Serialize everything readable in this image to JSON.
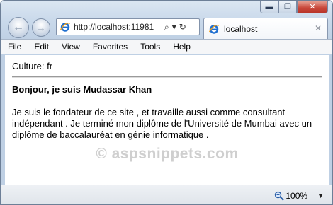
{
  "window": {
    "url": "http://localhost:11981",
    "tab_title": "localhost",
    "minimize_glyph": "▬",
    "restore_glyph": "❐",
    "close_glyph": "✕",
    "back_glyph": "←",
    "forward_glyph": "→",
    "search_glyph": "⌕",
    "dropdown_glyph": "▾",
    "refresh_glyph": "↻",
    "tab_close_glyph": "✕"
  },
  "menu": {
    "items": [
      "File",
      "Edit",
      "View",
      "Favorites",
      "Tools",
      "Help"
    ]
  },
  "page": {
    "culture": "Culture: fr",
    "greeting": "Bonjour, je suis Mudassar Khan",
    "bio": "Je suis le fondateur de ce site , et travaille aussi comme consultant indépendant . Je terminé mon diplôme de l'Université de Mumbai avec un diplôme de baccalauréat en génie informatique ."
  },
  "watermark": "© aspsnippets.com",
  "status": {
    "zoom": "100%",
    "zoom_caret": "▼"
  },
  "icons": {
    "browser": "ie-icon",
    "zoom": "magnifier-icon"
  },
  "colors": {
    "chrome": "#c8d8ea",
    "close_button": "#c9473a",
    "ie_blue": "#1f6fd0",
    "ie_orange": "#f2a21a"
  }
}
